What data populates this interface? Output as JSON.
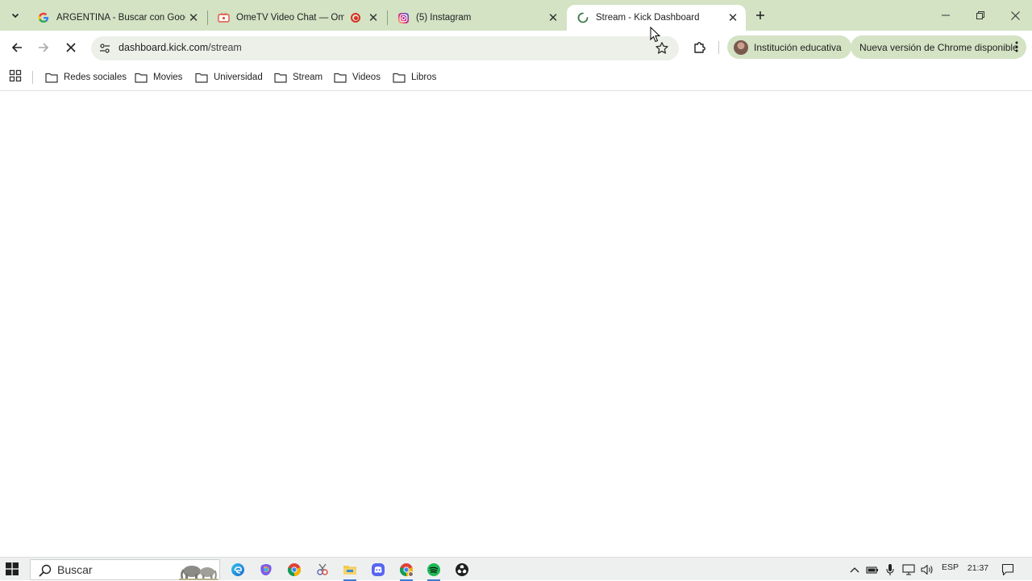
{
  "browser": {
    "tabs": [
      {
        "title": "ARGENTINA - Buscar con Google",
        "favicon": "google-icon"
      },
      {
        "title": "OmeTV Video Chat — Omegle",
        "favicon": "ometv-icon",
        "recording": true
      },
      {
        "title": "(5) Instagram",
        "favicon": "instagram-icon"
      },
      {
        "title": "Stream - Kick Dashboard",
        "favicon": "loading-spinner-icon",
        "active": true
      }
    ],
    "address": {
      "domain": "dashboard.kick.com",
      "path": "/stream"
    },
    "profile_label": "Institución educativa",
    "update_label": "Nueva versión de Chrome disponible"
  },
  "bookmarks": [
    {
      "label": "Redes sociales"
    },
    {
      "label": "Movies"
    },
    {
      "label": "Universidad"
    },
    {
      "label": "Stream"
    },
    {
      "label": "Videos"
    },
    {
      "label": "Libros"
    }
  ],
  "taskbar": {
    "search_placeholder": "Buscar",
    "language": "ESP",
    "time": "21:37"
  },
  "colors": {
    "tabstrip": "#d3e3c4",
    "omnibox": "#edefe9",
    "taskbar": "#eef0f0"
  }
}
